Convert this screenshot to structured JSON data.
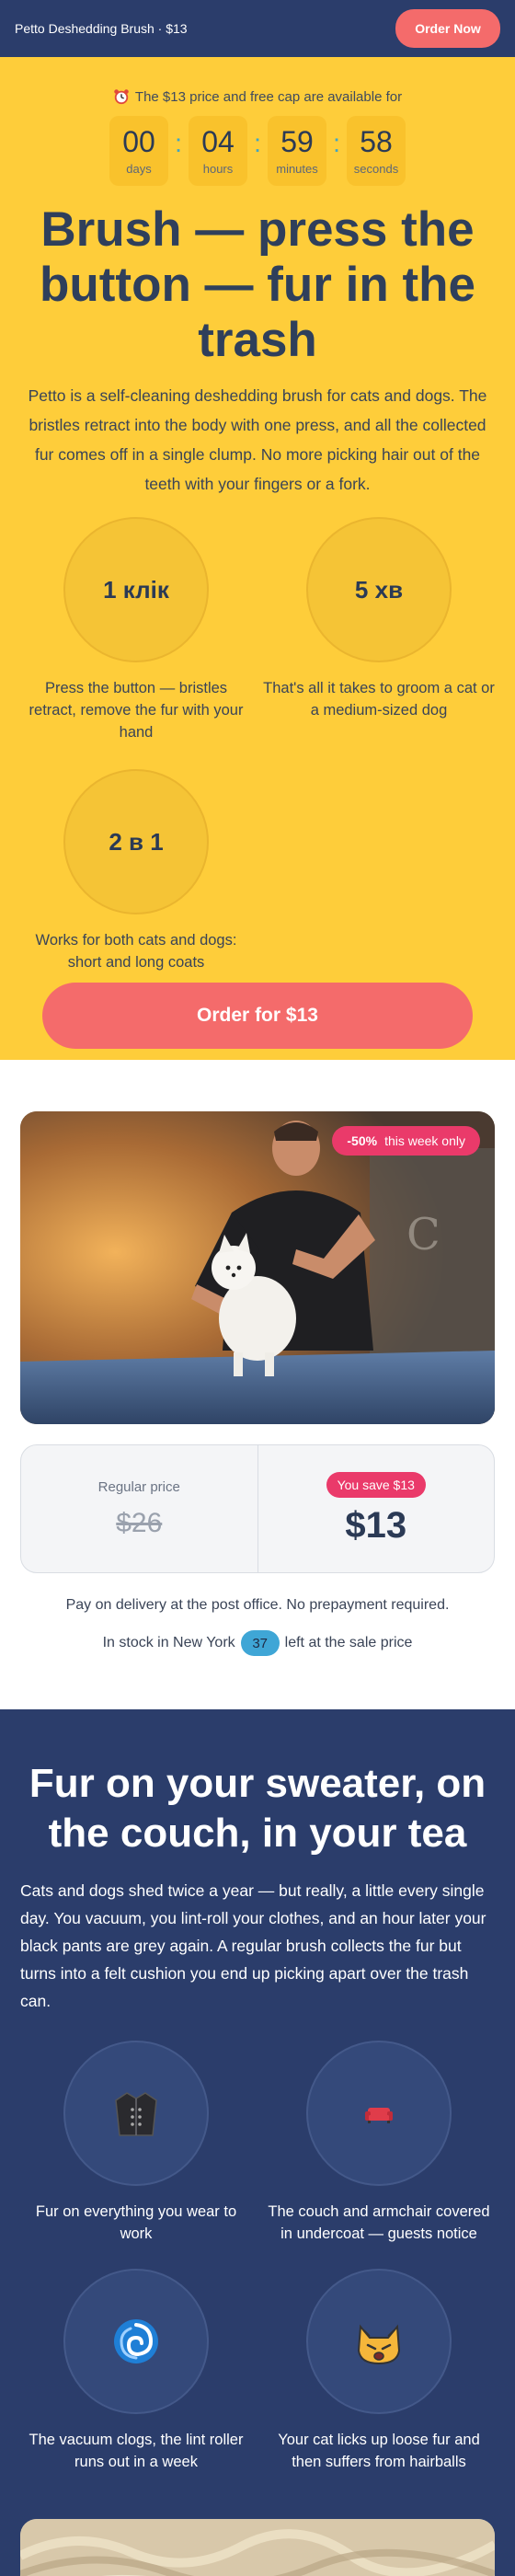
{
  "header": {
    "brand": "Petto Deshedding Brush · $13",
    "order_button": "Order Now"
  },
  "hero": {
    "offer_text": "The $13 price and free cap are available for",
    "countdown": [
      {
        "value": "00",
        "label": "days"
      },
      {
        "value": "04",
        "label": "hours"
      },
      {
        "value": "59",
        "label": "minutes"
      },
      {
        "value": "58",
        "label": "seconds"
      }
    ],
    "title": "Brush — press the button — fur in the trash",
    "description": "Petto is a self-cleaning deshedding brush for cats and dogs. The bristles retract into the body with one press, and all the collected fur comes off in a single clump. No more picking hair out of the teeth with your fingers or a fork.",
    "features": [
      {
        "badge": "1 клік",
        "text": "Press the button — bristles retract, remove the fur with your hand"
      },
      {
        "badge": "5 хв",
        "text": "That's all it takes to groom a cat or a medium-sized dog"
      },
      {
        "badge": "2 в 1",
        "text": "Works for both cats and dogs: short and long coats"
      }
    ],
    "order_button": "Order for $13"
  },
  "product": {
    "discount_percent": "-50%",
    "discount_note": "this week only",
    "regular_price_label": "Regular price",
    "old_price": "$26",
    "save_badge": "You save $13",
    "new_price": "$13",
    "payment_note": "Pay on delivery at the post office. No prepayment required.",
    "stock_prefix": "In stock in New York",
    "stock_count": "37",
    "stock_suffix": "left at the sale price"
  },
  "problem": {
    "title": "Fur on your sweater, on the couch, in your tea",
    "description": "Cats and dogs shed twice a year — but really, a little every single day. You vacuum, you lint-roll your clothes, and an hour later your black pants are grey again. A regular brush collects the fur but turns into a felt cushion you end up picking apart over the trash can.",
    "pains": [
      {
        "icon": "coat-icon",
        "text": "Fur on everything you wear to work"
      },
      {
        "icon": "couch-icon",
        "text": "The couch and armchair covered in undercoat — guests notice"
      },
      {
        "icon": "cyclone-icon",
        "text": "The vacuum clogs, the lint roller runs out in a week"
      },
      {
        "icon": "cat-face-icon",
        "text": "Your cat licks up loose fur and then suffers from hairballs"
      }
    ]
  },
  "colors": {
    "navy": "#2b3d6b",
    "yellow": "#fecd3a",
    "coral": "#f46b6b",
    "pink": "#ea3a6a",
    "cyan": "#3fa6d6"
  }
}
